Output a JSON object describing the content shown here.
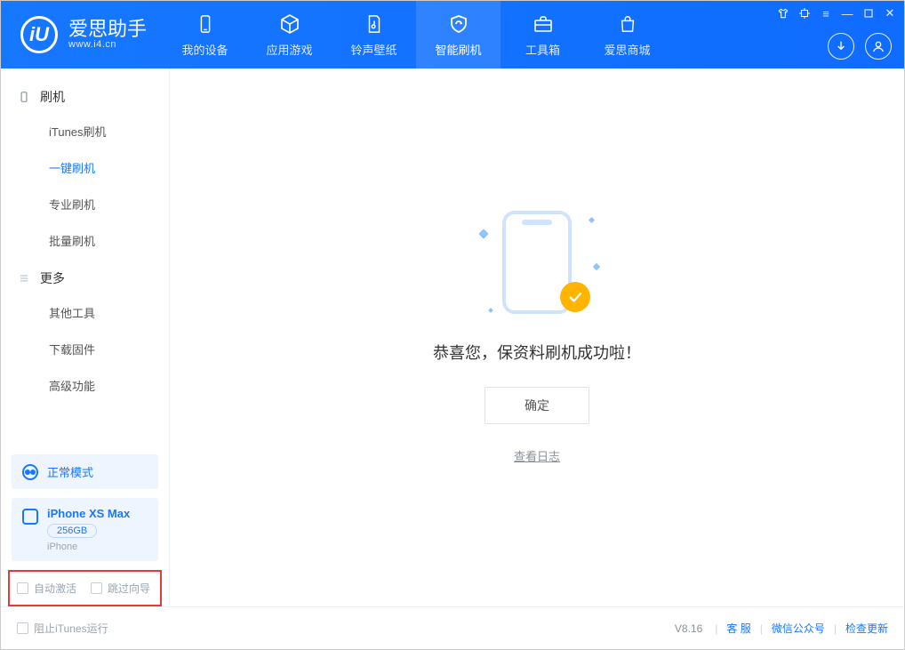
{
  "brand": {
    "cn": "爱思助手",
    "en": "www.i4.cn",
    "logo_letter": "iU"
  },
  "topnav": [
    {
      "key": "device",
      "label": "我的设备"
    },
    {
      "key": "apps",
      "label": "应用游戏"
    },
    {
      "key": "ring",
      "label": "铃声壁纸"
    },
    {
      "key": "flash",
      "label": "智能刷机",
      "active": true
    },
    {
      "key": "tools",
      "label": "工具箱"
    },
    {
      "key": "store",
      "label": "爱思商城"
    }
  ],
  "sidebar": {
    "group1": {
      "title": "刷机",
      "items": [
        {
          "key": "itunes",
          "label": "iTunes刷机"
        },
        {
          "key": "oneclick",
          "label": "一键刷机",
          "active": true
        },
        {
          "key": "pro",
          "label": "专业刷机"
        },
        {
          "key": "batch",
          "label": "批量刷机"
        }
      ]
    },
    "group2": {
      "title": "更多",
      "items": [
        {
          "key": "other",
          "label": "其他工具"
        },
        {
          "key": "firmware",
          "label": "下载固件"
        },
        {
          "key": "adv",
          "label": "高级功能"
        }
      ]
    },
    "mode_label": "正常模式",
    "device": {
      "name": "iPhone XS Max",
      "capacity": "256GB",
      "subtitle": "iPhone"
    },
    "opt1": "自动激活",
    "opt2": "跳过向导"
  },
  "main": {
    "success_msg": "恭喜您，保资料刷机成功啦！",
    "confirm": "确定",
    "view_log": "查看日志"
  },
  "status": {
    "block_itunes": "阻止iTunes运行",
    "version": "V8.16",
    "links": [
      "客 服",
      "微信公众号",
      "检查更新"
    ]
  }
}
